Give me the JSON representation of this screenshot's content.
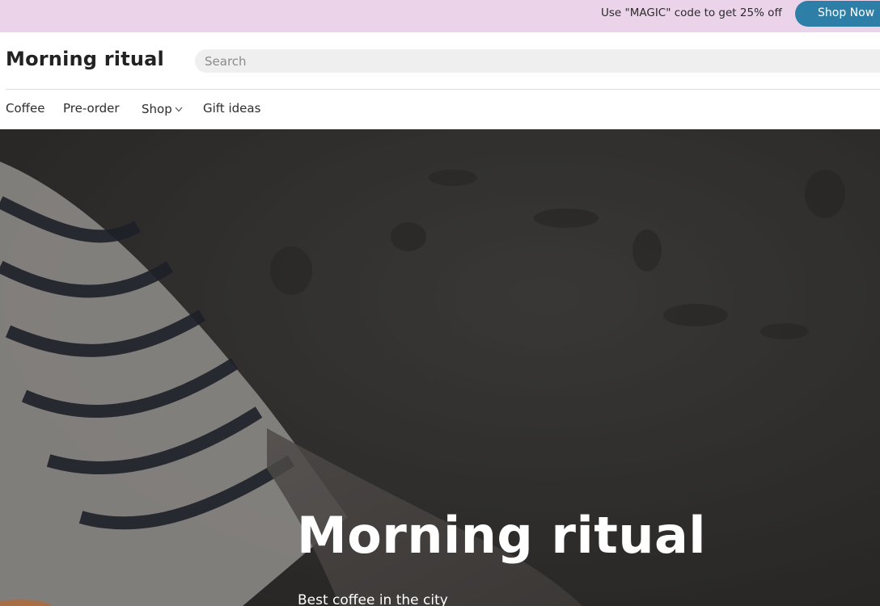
{
  "promo": {
    "text": "Use \"MAGIC\" code to get 25% off",
    "button_label": "Shop Now"
  },
  "header": {
    "logo": "Morning ritual",
    "search_placeholder": "Search"
  },
  "nav": {
    "items": [
      {
        "label": "Coffee"
      },
      {
        "label": "Pre-order"
      },
      {
        "label": "Shop",
        "icon": "chevron-down-icon"
      },
      {
        "label": "Gift ideas"
      }
    ]
  },
  "hero": {
    "title": "Morning ritual",
    "subtitle": "Best coffee in the city"
  },
  "colors": {
    "promo_bg": "#ebd3ea",
    "accent": "#2e7fa7",
    "hero_overlay": "#3c3a39"
  }
}
